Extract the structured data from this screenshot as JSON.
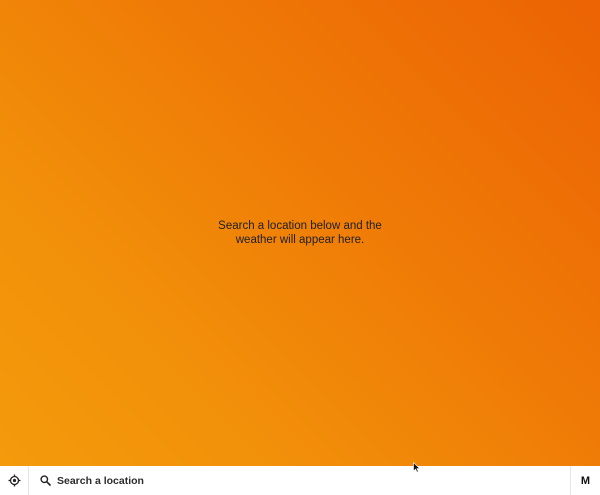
{
  "weather": {
    "empty_message": "Search a location below and the weather will appear here."
  },
  "bottom_bar": {
    "locate_icon": "crosshair-icon",
    "search_icon": "search-icon",
    "search_placeholder": "Search a location",
    "search_value": "",
    "unit_label": "M"
  },
  "colors": {
    "gradient_start": "#ec6304",
    "gradient_end": "#f49a0b",
    "bar_background": "#ffffff"
  }
}
